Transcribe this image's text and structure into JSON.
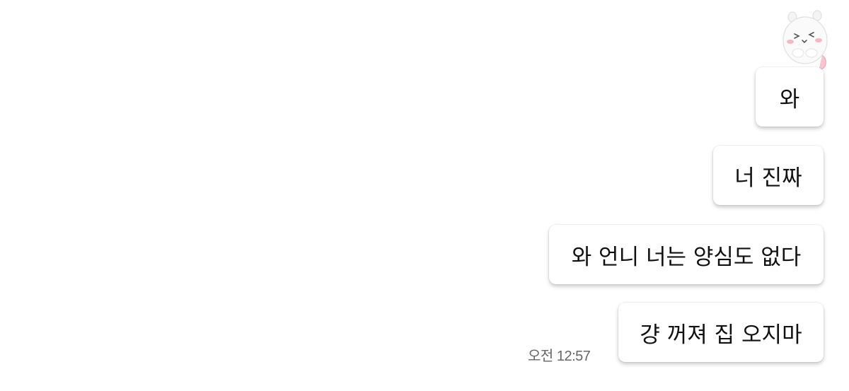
{
  "conversation": {
    "messages": [
      {
        "text": "와"
      },
      {
        "text": "너 진짜"
      },
      {
        "text": "와 언니 너는 양심도 없다"
      },
      {
        "text": "걍 꺼져 집 오지마"
      }
    ],
    "last_timestamp": "오전 12:57"
  },
  "sender": {
    "avatar_icon": "white-bear-sticker-icon"
  },
  "colors": {
    "background": "#ffffff",
    "bubble": "#ffffff",
    "text": "#111111",
    "timestamp": "#666666"
  }
}
